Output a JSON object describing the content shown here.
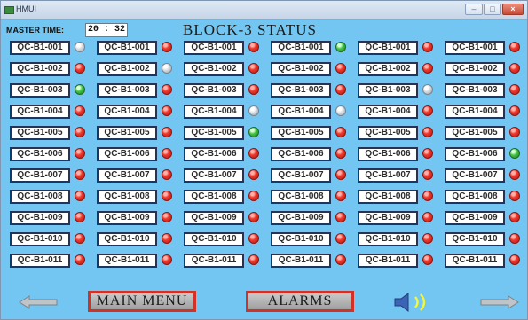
{
  "window": {
    "title": "HMUI",
    "controls": {
      "minimize": "–",
      "maximize": "□",
      "close": "×"
    }
  },
  "header": {
    "master_time_label": "MASTER TIME:",
    "master_time_value": "20 : 32",
    "title": "BLOCK-3 STATUS"
  },
  "grid": {
    "rows": [
      {
        "cells": [
          {
            "label": "QC-B1-001",
            "status": "gray"
          },
          {
            "label": "QC-B1-001",
            "status": "red"
          },
          {
            "label": "QC-B1-001",
            "status": "red"
          },
          {
            "label": "QC-B1-001",
            "status": "green"
          },
          {
            "label": "QC-B1-001",
            "status": "red"
          },
          {
            "label": "QC-B1-001",
            "status": "red"
          }
        ]
      },
      {
        "cells": [
          {
            "label": "QC-B1-002",
            "status": "red"
          },
          {
            "label": "QC-B1-002",
            "status": "gray"
          },
          {
            "label": "QC-B1-002",
            "status": "red"
          },
          {
            "label": "QC-B1-002",
            "status": "red"
          },
          {
            "label": "QC-B1-002",
            "status": "red"
          },
          {
            "label": "QC-B1-002",
            "status": "red"
          }
        ]
      },
      {
        "cells": [
          {
            "label": "QC-B1-003",
            "status": "green"
          },
          {
            "label": "QC-B1-003",
            "status": "red"
          },
          {
            "label": "QC-B1-003",
            "status": "red"
          },
          {
            "label": "QC-B1-003",
            "status": "red"
          },
          {
            "label": "QC-B1-003",
            "status": "gray"
          },
          {
            "label": "QC-B1-003",
            "status": "red"
          }
        ]
      },
      {
        "cells": [
          {
            "label": "QC-B1-004",
            "status": "red"
          },
          {
            "label": "QC-B1-004",
            "status": "red"
          },
          {
            "label": "QC-B1-004",
            "status": "gray"
          },
          {
            "label": "QC-B1-004",
            "status": "gray"
          },
          {
            "label": "QC-B1-004",
            "status": "red"
          },
          {
            "label": "QC-B1-004",
            "status": "red"
          }
        ]
      },
      {
        "cells": [
          {
            "label": "QC-B1-005",
            "status": "red"
          },
          {
            "label": "QC-B1-005",
            "status": "red"
          },
          {
            "label": "QC-B1-005",
            "status": "green"
          },
          {
            "label": "QC-B1-005",
            "status": "red"
          },
          {
            "label": "QC-B1-005",
            "status": "red"
          },
          {
            "label": "QC-B1-005",
            "status": "red"
          }
        ]
      },
      {
        "cells": [
          {
            "label": "QC-B1-006",
            "status": "red"
          },
          {
            "label": "QC-B1-006",
            "status": "red"
          },
          {
            "label": "QC-B1-006",
            "status": "red"
          },
          {
            "label": "QC-B1-006",
            "status": "red"
          },
          {
            "label": "QC-B1-006",
            "status": "red"
          },
          {
            "label": "QC-B1-006",
            "status": "green"
          }
        ]
      },
      {
        "cells": [
          {
            "label": "QC-B1-007",
            "status": "red"
          },
          {
            "label": "QC-B1-007",
            "status": "red"
          },
          {
            "label": "QC-B1-007",
            "status": "red"
          },
          {
            "label": "QC-B1-007",
            "status": "red"
          },
          {
            "label": "QC-B1-007",
            "status": "red"
          },
          {
            "label": "QC-B1-007",
            "status": "red"
          }
        ]
      },
      {
        "cells": [
          {
            "label": "QC-B1-008",
            "status": "red"
          },
          {
            "label": "QC-B1-008",
            "status": "red"
          },
          {
            "label": "QC-B1-008",
            "status": "red"
          },
          {
            "label": "QC-B1-008",
            "status": "red"
          },
          {
            "label": "QC-B1-008",
            "status": "red"
          },
          {
            "label": "QC-B1-008",
            "status": "red"
          }
        ]
      },
      {
        "cells": [
          {
            "label": "QC-B1-009",
            "status": "red"
          },
          {
            "label": "QC-B1-009",
            "status": "red"
          },
          {
            "label": "QC-B1-009",
            "status": "red"
          },
          {
            "label": "QC-B1-009",
            "status": "red"
          },
          {
            "label": "QC-B1-009",
            "status": "red"
          },
          {
            "label": "QC-B1-009",
            "status": "red"
          }
        ]
      },
      {
        "cells": [
          {
            "label": "QC-B1-010",
            "status": "red"
          },
          {
            "label": "QC-B1-010",
            "status": "red"
          },
          {
            "label": "QC-B1-010",
            "status": "red"
          },
          {
            "label": "QC-B1-010",
            "status": "red"
          },
          {
            "label": "QC-B1-010",
            "status": "red"
          },
          {
            "label": "QC-B1-010",
            "status": "red"
          }
        ]
      },
      {
        "cells": [
          {
            "label": "QC-B1-011",
            "status": "red"
          },
          {
            "label": "QC-B1-011",
            "status": "red"
          },
          {
            "label": "QC-B1-011",
            "status": "red"
          },
          {
            "label": "QC-B1-011",
            "status": "red"
          },
          {
            "label": "QC-B1-011",
            "status": "red"
          },
          {
            "label": "QC-B1-011",
            "status": "red"
          }
        ]
      }
    ]
  },
  "footer": {
    "main_menu_label": "MAIN MENU",
    "alarms_label": "ALARMS",
    "left_icon": "left-arrow-icon",
    "right_icon": "right-arrow-icon",
    "sound_icon": "speaker-icon"
  },
  "colors": {
    "screen_background": "#72c6f1",
    "status_red": "#f13a2d",
    "status_green": "#45c747",
    "status_gray": "#d7dce1",
    "button_border": "#d23125"
  }
}
